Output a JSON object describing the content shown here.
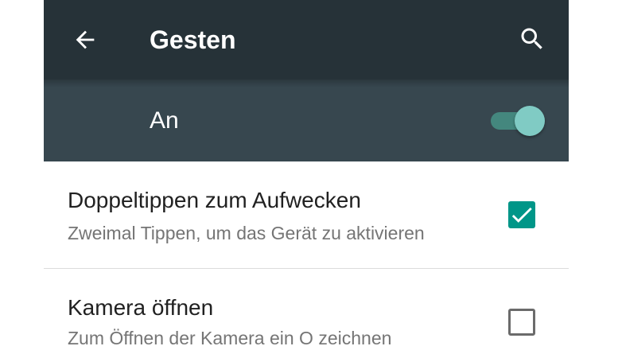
{
  "appbar": {
    "title": "Gesten",
    "back_icon": "arrow-back-icon",
    "search_icon": "search-icon"
  },
  "master_switch": {
    "label": "An",
    "state": "on"
  },
  "settings": [
    {
      "title": "Doppeltippen zum Aufwecken",
      "summary": "Zweimal Tippen, um das Gerät zu aktivieren",
      "checked": true
    },
    {
      "title": "Kamera öffnen",
      "summary": "Zum Öffnen der Kamera ein O zeichnen",
      "checked": false
    }
  ],
  "colors": {
    "appbar": "#263238",
    "master_bar": "#37474f",
    "accent": "#009688",
    "switch_thumb": "#80cbc4",
    "switch_track": "#44877e",
    "title_text": "#212121",
    "summary_text": "#757575"
  }
}
